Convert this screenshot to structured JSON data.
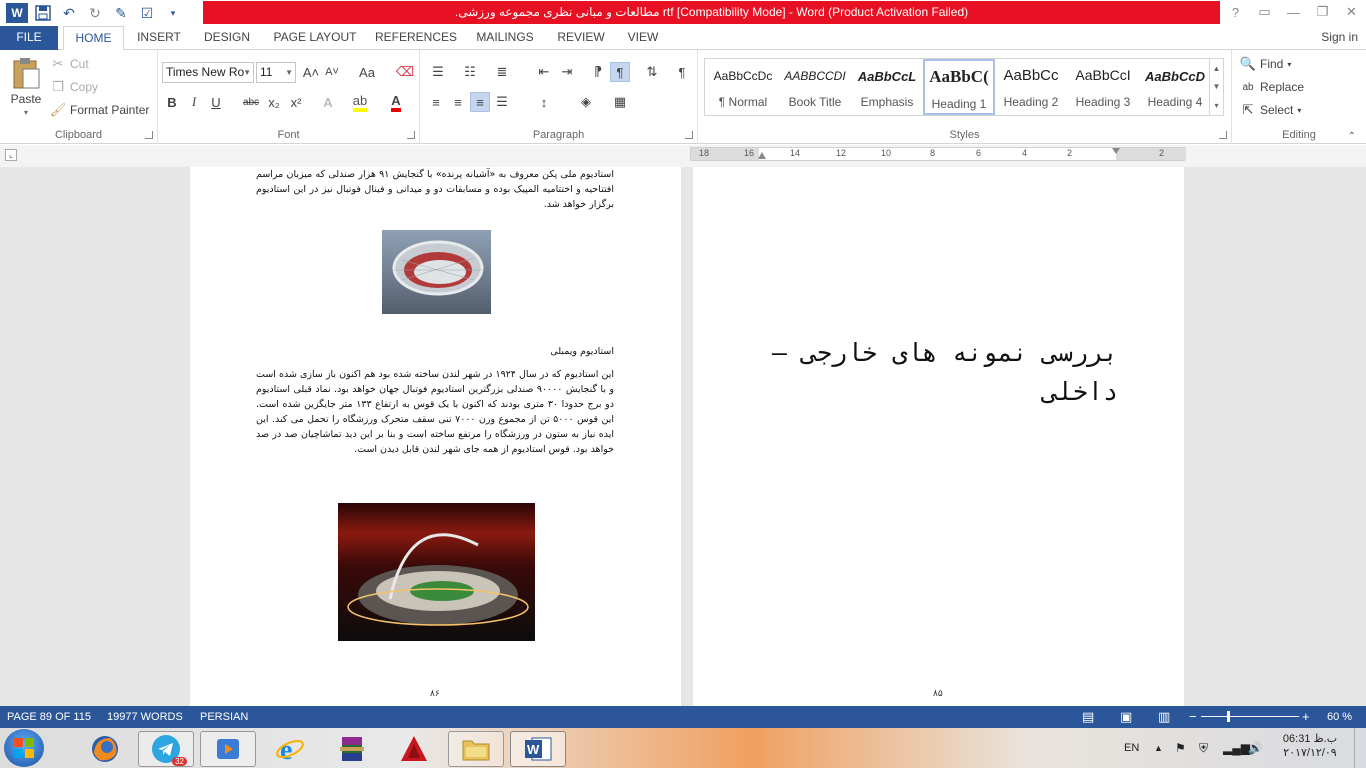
{
  "app": {
    "title": ".مطالعات و مبانی نظری مجموعه ورزشی rtf [Compatibility Mode] -  Word (Product Activation Failed)"
  },
  "window_controls": {
    "help": "?",
    "restore_ribbon": "▭",
    "minimize": "—",
    "maximize": "❐",
    "close": "✕"
  },
  "tabs": [
    "FILE",
    "HOME",
    "INSERT",
    "DESIGN",
    "PAGE LAYOUT",
    "REFERENCES",
    "MAILINGS",
    "REVIEW",
    "VIEW"
  ],
  "signin": "Sign in",
  "clipboard": {
    "paste": "Paste",
    "cut": "Cut",
    "copy": "Copy",
    "format_painter": "Format Painter",
    "label": "Clipboard"
  },
  "font": {
    "family": "Times New Ro",
    "size": "11",
    "label": "Font",
    "grow": "A˄",
    "shrink": "A˅",
    "case": "Aa",
    "bold": "B",
    "italic": "I",
    "underline": "U",
    "strike": "abc",
    "sub": "x₂",
    "sup": "x²"
  },
  "paragraph": {
    "label": "Paragraph",
    "pilcrow": "¶"
  },
  "styles": {
    "label": "Styles",
    "items": [
      {
        "preview": "AaBbCcDc",
        "name": "¶ Normal"
      },
      {
        "preview": "AABBCCDI",
        "name": "Book Title"
      },
      {
        "preview": "AaBbCcL",
        "name": "Emphasis"
      },
      {
        "preview": "AaBbC(",
        "name": "Heading 1"
      },
      {
        "preview": "AaBbCc",
        "name": "Heading 2"
      },
      {
        "preview": "AaBbCcI",
        "name": "Heading 3"
      },
      {
        "preview": "AaBbCcD",
        "name": "Heading 4"
      }
    ]
  },
  "editing": {
    "find": "Find",
    "replace": "Replace",
    "select": "Select",
    "label": "Editing"
  },
  "ruler": {
    "ticks": [
      "18",
      "16",
      "14",
      "12",
      "10",
      "8",
      "6",
      "4",
      "2",
      "2"
    ]
  },
  "left_page": {
    "para1": "استادیوم ملی پکن معروف به «آشیانه پرنده» با گنجایش ۹۱ هزار صندلی که میزبان مراسم افتتاحیه و اختتامیه المپیک بوده و مسابقات دو و میدانی و فینال فوتبال نیز در این استادیوم برگزار خواهد شد.",
    "heading": "استادیوم ویمبلی",
    "para2": "این استادیوم که در سال ۱۹۲۴ در شهر لندن ساخته شده بود هم اکنون باز سازی شده است و با گنجایش ۹۰۰۰۰ صندلی بزرگترین استادیوم فوتبال جهان خواهد بود. نماد قبلی استادیوم دو برج حدودا ۳۰ متری بودند که اکنون با یک قوس به ارتفاع ۱۳۳ متر جایگزین شده است. این قوس ۵۰۰۰ تن از مجموع وزن ۷۰۰۰ تنی سقف متحرک ورزشگاه را تحمل می کند. این ایده نیاز به ستون در ورزشگاه را مرتفع ساخته است و بنا بر این دید تماشاچیان صد در صد خواهد بود. قوس استادیوم از همه جای شهر لندن قابل دیدن است.",
    "page_number": "۸۶"
  },
  "right_page": {
    "heading": "بررسی نمونه های خارجی – داخلی",
    "page_number": "۸۵"
  },
  "status": {
    "page": "PAGE 89 OF 115",
    "words": "19977 WORDS",
    "language": "PERSIAN",
    "zoom": "60 %"
  },
  "taskbar": {
    "telegram_badge": "32",
    "lang": "EN",
    "time": "06:31 ب.ظ",
    "date": "۲۰۱۷/۱۲/۰۹"
  }
}
